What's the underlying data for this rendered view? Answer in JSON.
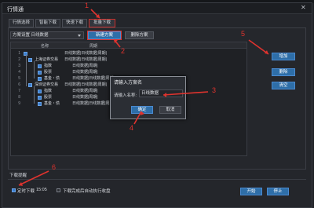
{
  "window": {
    "title": "行情通",
    "close_label": "✕"
  },
  "tabs": [
    {
      "label": "行情选择"
    },
    {
      "label": "智能下载"
    },
    {
      "label": "快速下载"
    },
    {
      "label": "批量下载"
    }
  ],
  "toolbar": {
    "scheme_dropdown": "方案设置 日线数据",
    "create_button": "新建方案",
    "delete_button": "删除方案"
  },
  "tree": {
    "col_name": "名称",
    "col_period": "周期",
    "rows": [
      {
        "num": "1",
        "name": "",
        "period": "日线数据|日线数据|周期|"
      },
      {
        "num": "2",
        "name": "上海证券交易",
        "period": "日线数据|日线数据|周期|"
      },
      {
        "num": "3",
        "name": "指数",
        "period": "日线数据|周期|"
      },
      {
        "num": "4",
        "name": "股票",
        "period": "日线数据|周期|"
      },
      {
        "num": "5",
        "name": "基金・债",
        "period": "日线数据|日线数据|周期|"
      },
      {
        "num": "6",
        "name": "深圳证券交易",
        "period": "日线数据|日线数据|周期|"
      },
      {
        "num": "7",
        "name": "指数",
        "period": "日线数据|周期|"
      },
      {
        "num": "8",
        "name": "股票",
        "period": "日线数据|周期|"
      },
      {
        "num": "9",
        "name": "基金・债",
        "period": "日线数据|日线数据|周期|"
      }
    ]
  },
  "side_buttons": {
    "add": "增加",
    "delete": "删除",
    "clear": "清空"
  },
  "dialog": {
    "title": "请输入方案名",
    "label": "请输入名称:",
    "value": "日线数据",
    "ok": "确定",
    "cancel": "取消"
  },
  "footer": {
    "section_label": "下载提醒",
    "timer_label": "定时下载",
    "timer_value": "15:05",
    "auto_label": "下载完成后自动执行收盘",
    "start_button": "开始",
    "stop_button": "停止"
  },
  "annotations": [
    "1",
    "2",
    "3",
    "4",
    "5",
    "6"
  ],
  "colors": {
    "accent": "#2e6ea8",
    "callout": "#e0332e",
    "background": "#24262b"
  }
}
